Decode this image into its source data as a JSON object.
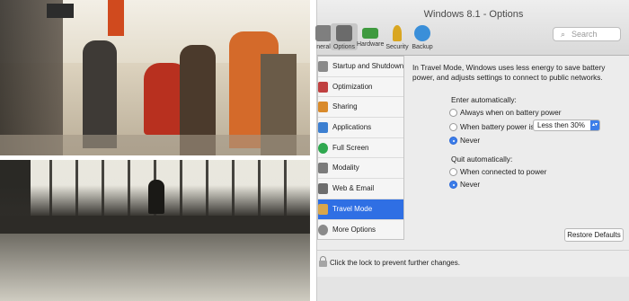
{
  "window": {
    "title": "Windows 8.1 - Options"
  },
  "toolbar": {
    "items": [
      {
        "label": "neral",
        "icon": "general-icon",
        "color": "#7f7f7f"
      },
      {
        "label": "Options",
        "icon": "options-icon",
        "color": "#6b6b6b"
      },
      {
        "label": "Hardware",
        "icon": "hardware-icon",
        "color": "#3f9a3f"
      },
      {
        "label": "Security",
        "icon": "key-icon",
        "color": "#d9a621"
      },
      {
        "label": "Backup",
        "icon": "backup-icon",
        "color": "#3a8fd9"
      }
    ],
    "search_placeholder": "Search"
  },
  "sidebar": {
    "items": [
      {
        "label": "Startup and Shutdown",
        "color": "#8a8a8a"
      },
      {
        "label": "Optimization",
        "color": "#c04040"
      },
      {
        "label": "Sharing",
        "color": "#d98a2b"
      },
      {
        "label": "Applications",
        "color": "#3c7fd1"
      },
      {
        "label": "Full Screen",
        "color": "#2fa84f"
      },
      {
        "label": "Modality",
        "color": "#7b7b7b"
      },
      {
        "label": "Web & Email",
        "color": "#6d6d6d"
      },
      {
        "label": "Travel Mode",
        "color": "#d8a64a"
      },
      {
        "label": "More Options",
        "color": "#8a8a8a"
      }
    ],
    "selected": "Travel Mode"
  },
  "content": {
    "description": "In Travel Mode, Windows uses less energy to save battery power, and adjusts settings to connect to public networks.",
    "enter": {
      "title": "Enter automatically:",
      "options": [
        "Always when on battery power",
        "When battery power is",
        "Never"
      ],
      "selected": "Never",
      "select_value": "Less then 30%"
    },
    "quit": {
      "title": "Quit automatically:",
      "options": [
        "When connected to power",
        "Never"
      ],
      "selected": "Never"
    },
    "restore_label": "Restore Defaults"
  },
  "footer": {
    "text": "Click the lock to prevent further changes."
  },
  "colors": {
    "accent": "#2f6fe4"
  }
}
